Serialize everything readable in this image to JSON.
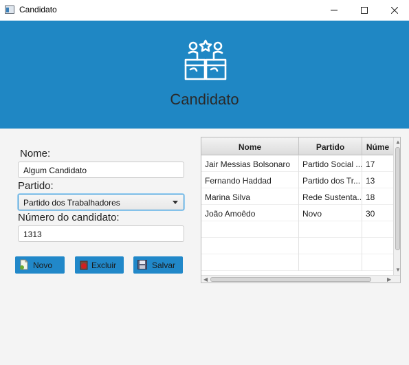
{
  "window": {
    "title": "Candidato"
  },
  "banner": {
    "title": "Candidato",
    "background_color": "#1f87c4",
    "icon": "candidates-podium-icon"
  },
  "form": {
    "nome_label": "Nome:",
    "nome_value": "Algum Candidato",
    "partido_label": "Partido:",
    "partido_selected": "Partido dos Trabalhadores",
    "numero_label": "Número do candidato:",
    "numero_value": "1313"
  },
  "buttons": {
    "novo": "Novo",
    "excluir": "Excluir",
    "salvar": "Salvar",
    "color": "#2188c9"
  },
  "table": {
    "headers": [
      "Nome",
      "Partido",
      "Núme"
    ],
    "rows": [
      [
        "Jair Messias Bolsonaro",
        "Partido Social ...",
        "17"
      ],
      [
        "Fernando Haddad",
        "Partido dos Tr...",
        "13"
      ],
      [
        "Marina Silva",
        "Rede Sustenta...",
        "18"
      ],
      [
        "João Amoêdo",
        "Novo",
        "30"
      ]
    ]
  }
}
